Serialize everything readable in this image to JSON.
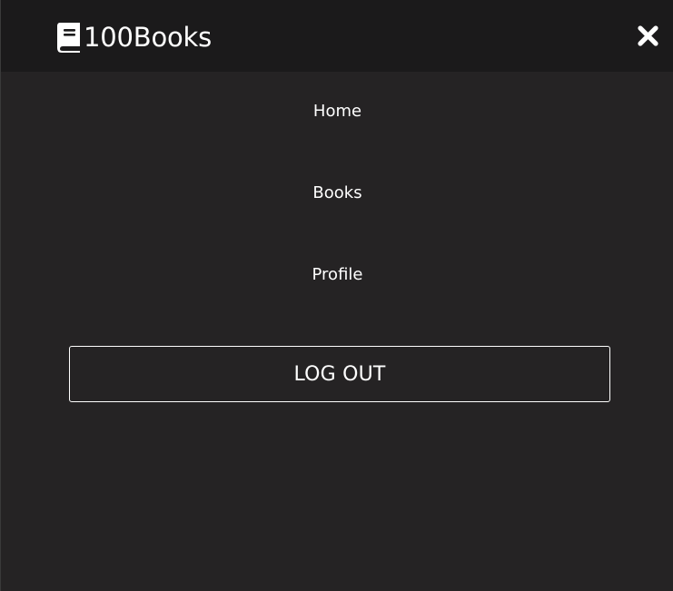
{
  "header": {
    "brand_name": "100Books",
    "brand_icon": "book-icon",
    "close_icon": "close-icon"
  },
  "menu": {
    "items": [
      {
        "label": "Home"
      },
      {
        "label": "Books"
      },
      {
        "label": "Profile"
      }
    ],
    "logout_label": "LOG OUT"
  },
  "colors": {
    "topbar_background": "#1b1a1b",
    "menu_background": "#252324",
    "text": "#ffffff",
    "button_border": "#ffffff"
  }
}
